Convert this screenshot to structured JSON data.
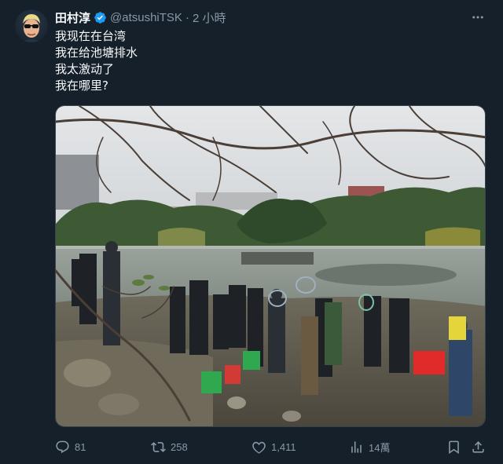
{
  "tweet": {
    "display_name": "田村淳",
    "handle": "@atsushiTSK",
    "separator": "·",
    "time": "2 小時",
    "lines": [
      "我现在在台湾",
      "我在给池塘排水",
      "我太激动了",
      "我在哪里?"
    ],
    "media_description_icon": "photo"
  },
  "actions": {
    "replies": "81",
    "retweets": "258",
    "likes": "1,411",
    "views": "14萬"
  },
  "colors": {
    "background": "#15202b",
    "text_primary": "#f7f9f9",
    "text_secondary": "#8b98a5",
    "verified": "#1d9bf0"
  },
  "icons": {
    "verified": "verified-badge-icon",
    "more": "more-dots-icon",
    "reply": "reply-icon",
    "retweet": "retweet-icon",
    "like": "heart-icon",
    "views": "views-bar-chart-icon",
    "bookmark": "bookmark-icon",
    "share": "share-icon"
  }
}
